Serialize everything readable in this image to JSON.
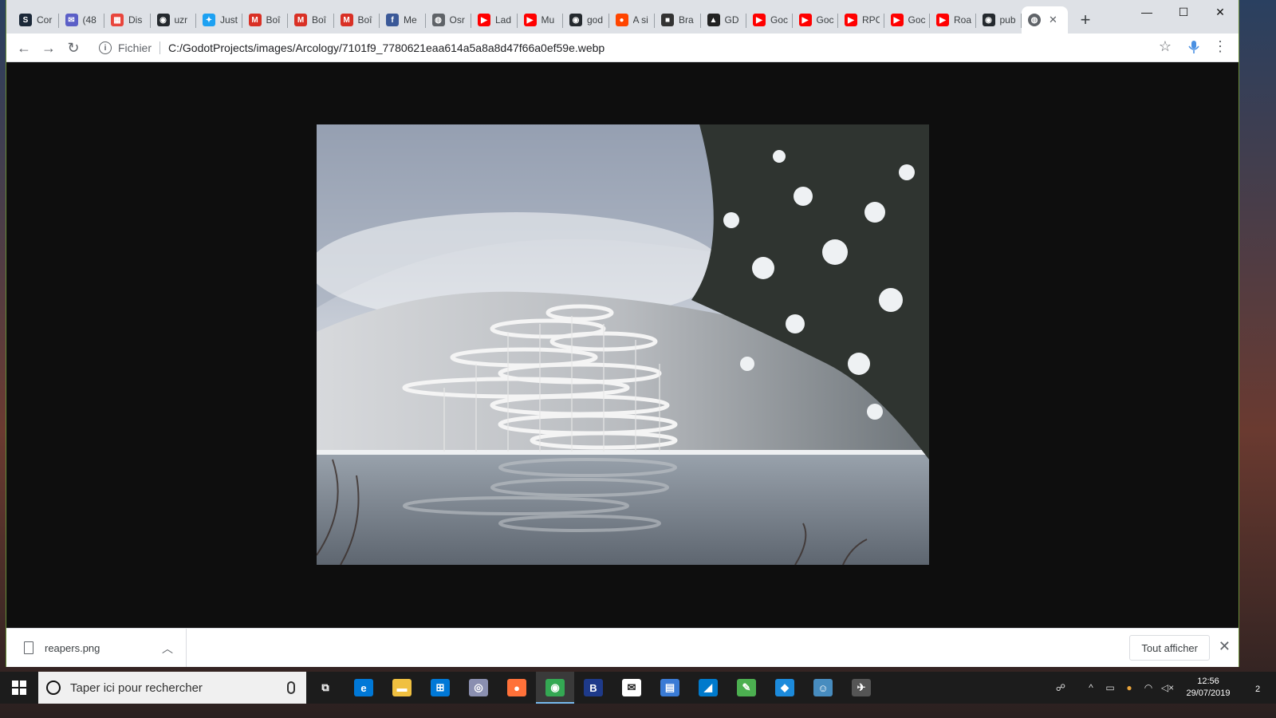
{
  "browser": {
    "tabs": [
      {
        "title": "Cor",
        "icon": "steam-icon",
        "color": "#1b2838",
        "glyph": "S"
      },
      {
        "title": "(48",
        "icon": "mail-icon",
        "color": "#5b5fc7",
        "glyph": "✉"
      },
      {
        "title": "Dis",
        "icon": "calendar-icon",
        "color": "#e8453c",
        "glyph": "▦"
      },
      {
        "title": "uzr",
        "icon": "github-icon",
        "color": "#24292e",
        "glyph": "◉"
      },
      {
        "title": "Just",
        "icon": "twitter-icon",
        "color": "#1da1f2",
        "glyph": "✦"
      },
      {
        "title": "Boî",
        "icon": "gmail-icon",
        "color": "#d93025",
        "glyph": "M"
      },
      {
        "title": "Boî",
        "icon": "gmail-icon",
        "color": "#d93025",
        "glyph": "M"
      },
      {
        "title": "Boî",
        "icon": "gmail-icon",
        "color": "#d93025",
        "glyph": "M"
      },
      {
        "title": "Me",
        "icon": "facebook-icon",
        "color": "#3b5998",
        "glyph": "f"
      },
      {
        "title": "Osr",
        "icon": "globe-icon",
        "color": "#5f6368",
        "glyph": "◍"
      },
      {
        "title": "Lad",
        "icon": "youtube-icon",
        "color": "#ff0000",
        "glyph": "▶"
      },
      {
        "title": "Mu",
        "icon": "youtube-icon",
        "color": "#ff0000",
        "glyph": "▶"
      },
      {
        "title": "god",
        "icon": "github-icon",
        "color": "#24292e",
        "glyph": "◉"
      },
      {
        "title": "A si",
        "icon": "reddit-icon",
        "color": "#ff4500",
        "glyph": "●"
      },
      {
        "title": "Bra",
        "icon": "page-icon",
        "color": "#333333",
        "glyph": "■"
      },
      {
        "title": "GD",
        "icon": "graduation-cap-icon",
        "color": "#222222",
        "glyph": "▲"
      },
      {
        "title": "Goc",
        "icon": "youtube-icon",
        "color": "#ff0000",
        "glyph": "▶"
      },
      {
        "title": "Goc",
        "icon": "youtube-icon",
        "color": "#ff0000",
        "glyph": "▶"
      },
      {
        "title": "RPC",
        "icon": "youtube-icon",
        "color": "#ff0000",
        "glyph": "▶"
      },
      {
        "title": "Goc",
        "icon": "youtube-icon",
        "color": "#ff0000",
        "glyph": "▶"
      },
      {
        "title": "Roa",
        "icon": "youtube-icon",
        "color": "#ff0000",
        "glyph": "▶"
      },
      {
        "title": "pub",
        "icon": "github-icon",
        "color": "#24292e",
        "glyph": "◉"
      }
    ],
    "active_tab": {
      "icon": "globe-icon",
      "close": "✕"
    },
    "new_tab": "+",
    "window_controls": {
      "minimize": "—",
      "maximize": "☐",
      "close": "✕"
    },
    "address": {
      "scheme_label": "Fichier",
      "url": "C:/GodotProjects/images/Arcology/7101f9_7780621eaa614a5a8a8d47f66a0ef59e.webp"
    }
  },
  "downloads": {
    "file_name": "reapers.png",
    "show_all_label": "Tout afficher"
  },
  "taskbar": {
    "search_placeholder": "Taper ici pour rechercher",
    "apps": [
      {
        "name": "task-view-icon",
        "color": "transparent",
        "glyph": "⧉"
      },
      {
        "name": "edge-icon",
        "color": "#0078d7",
        "glyph": "e"
      },
      {
        "name": "file-explorer-icon",
        "color": "#f0c040",
        "glyph": "▬"
      },
      {
        "name": "store-icon",
        "color": "#0078d7",
        "glyph": "⊞"
      },
      {
        "name": "camera-icon",
        "color": "#8a8fb0",
        "glyph": "◎"
      },
      {
        "name": "firefox-icon",
        "color": "#ff7139",
        "glyph": "●"
      },
      {
        "name": "chrome-icon",
        "color": "#34a853",
        "glyph": "◉"
      },
      {
        "name": "b-app-icon",
        "color": "#1e3a8a",
        "glyph": "B"
      },
      {
        "name": "mail-icon",
        "color": "#ffffff",
        "glyph": "✉"
      },
      {
        "name": "monitor-icon",
        "color": "#3a7bd5",
        "glyph": "▤"
      },
      {
        "name": "vscode-icon",
        "color": "#007acc",
        "glyph": "◢"
      },
      {
        "name": "notepad-icon",
        "color": "#4caf50",
        "glyph": "✎"
      },
      {
        "name": "azure-icon",
        "color": "#1c8adb",
        "glyph": "◆"
      },
      {
        "name": "godot-icon",
        "color": "#478cbf",
        "glyph": "☺"
      },
      {
        "name": "game-icon",
        "color": "#555555",
        "glyph": "✈"
      }
    ],
    "time": "12:56",
    "date": "29/07/2019",
    "notifications_count": "2"
  }
}
